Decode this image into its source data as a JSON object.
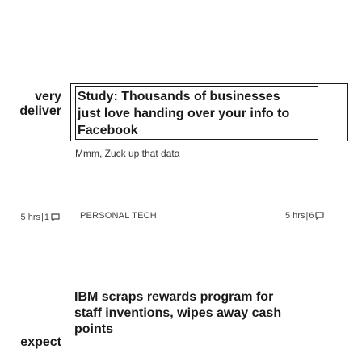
{
  "left_column": {
    "top_headline_lines": [
      "very",
      "deliver"
    ],
    "meta": {
      "time": "5 hrs",
      "separator": "|",
      "comments": "1"
    },
    "bottom_headline_lines": [
      "expect"
    ]
  },
  "featured": {
    "headline_lines": [
      "Study: Thousands of businesses",
      "just love handing over your info to",
      "Facebook"
    ],
    "dek": "Mmm, Zuck up that data"
  },
  "article": {
    "section": "PERSONAL TECH",
    "meta": {
      "time": "5 hrs",
      "separator": "|",
      "comments": "6"
    },
    "headline_lines": [
      "IBM scraps rewards program for",
      "staff inventions, wipes away cash",
      "points"
    ]
  },
  "icons": {
    "comment": "comment-bubble-icon"
  }
}
